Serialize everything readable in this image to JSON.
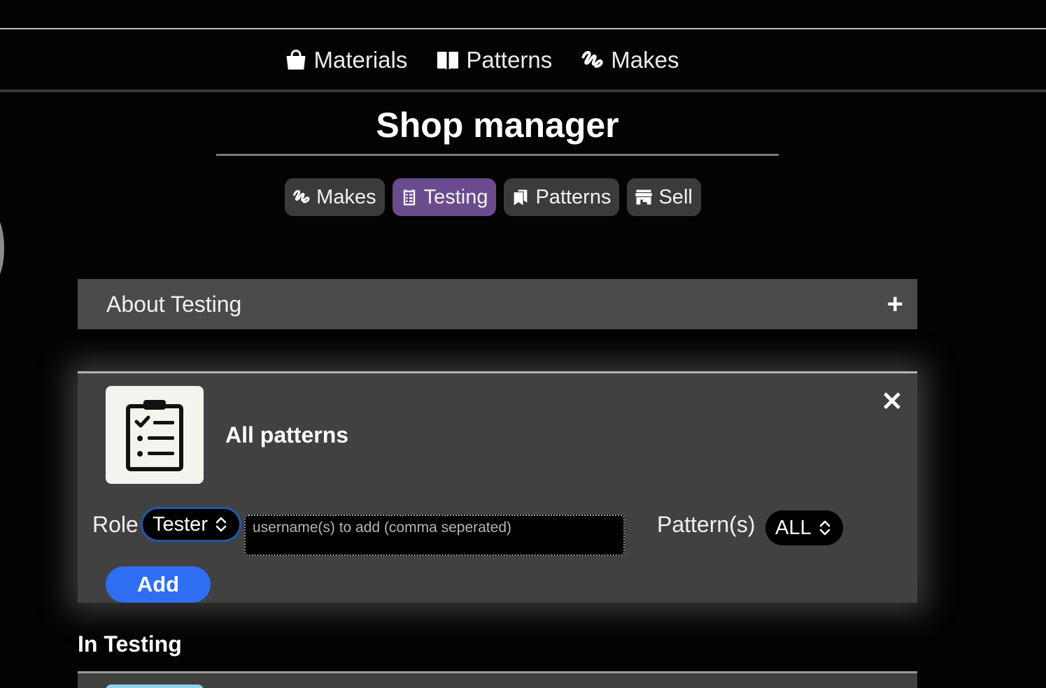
{
  "main_nav": {
    "items": [
      {
        "label": "Materials",
        "icon": "shopping-bag-icon"
      },
      {
        "label": "Patterns",
        "icon": "open-book-icon"
      },
      {
        "label": "Makes",
        "icon": "yarn-squiggle-icon"
      }
    ]
  },
  "page_title": "Shop manager",
  "shop_tabs": [
    {
      "label": "Makes",
      "icon": "yarn-squiggle-icon",
      "active": false
    },
    {
      "label": "Testing",
      "icon": "clipboard-list-icon",
      "active": true
    },
    {
      "label": "Patterns",
      "icon": "bookmark-book-icon",
      "active": false
    },
    {
      "label": "Sell",
      "icon": "storefront-icon",
      "active": false
    }
  ],
  "about_section": {
    "label": "About Testing",
    "expand_icon": "plus-icon"
  },
  "test_card": {
    "title": "All patterns",
    "image_icon": "clipboard-checklist-icon",
    "close_icon": "close-icon",
    "role_label": "Role",
    "role_value": "Tester",
    "usernames_placeholder": "username(s) to add (comma seperated)",
    "usernames_value": "",
    "patterns_label": "Pattern(s)",
    "patterns_value": "ALL",
    "add_button": "Add"
  },
  "in_testing": {
    "heading": "In Testing"
  },
  "colors": {
    "background": "#050203",
    "active_tab": "#6a4c8e",
    "chip": "#3b3b3b",
    "panel": "#414141",
    "accent_button": "#2f6ef2",
    "focus_ring": "#1e5aa8"
  }
}
